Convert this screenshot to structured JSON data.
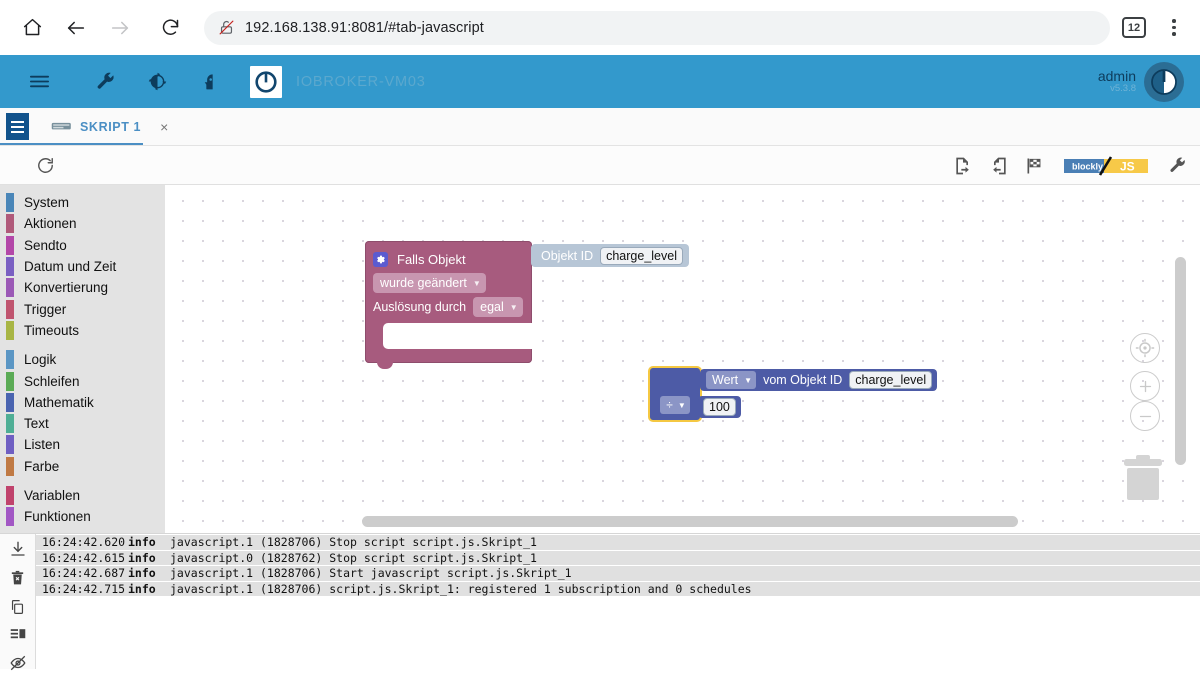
{
  "browser": {
    "url": "192.168.138.91:8081/#tab-javascript",
    "tab_count": "12",
    "icons": {
      "home": "home-icon",
      "back": "back-arrow-icon",
      "forward": "forward-arrow-icon",
      "reload": "reload-icon",
      "not_secure": "not-secure-icon",
      "menu": "kebab-menu-icon"
    }
  },
  "app_header": {
    "host": "IOBROKER-VM03",
    "user": "admin",
    "version": "v5.3.8",
    "accent": "#3399cc",
    "icons": [
      "hamburger-menu-icon",
      "wrench-icon",
      "contrast-icon",
      "user-head-icon",
      "iobroker-logo-icon"
    ]
  },
  "script_tab": {
    "label": "SKRIPT 1",
    "close": "×",
    "icon": "blockly-script-icon"
  },
  "blockly_toolbar": {
    "reload": "reload-icon",
    "export": "export-blocks-icon",
    "import": "import-blocks-icon",
    "flag": "checkered-flag-icon",
    "toggle_left": "blockly",
    "toggle_right": "JS",
    "settings": "wrench-icon"
  },
  "palette": {
    "groups": [
      {
        "items": [
          {
            "label": "System",
            "color": "#4a86b8"
          },
          {
            "label": "Aktionen",
            "color": "#b05a7a"
          },
          {
            "label": "Sendto",
            "color": "#b347a8"
          },
          {
            "label": "Datum und Zeit",
            "color": "#7a5fc2"
          },
          {
            "label": "Konvertierung",
            "color": "#9b59b6"
          },
          {
            "label": "Trigger",
            "color": "#c0556f"
          },
          {
            "label": "Timeouts",
            "color": "#a8b544"
          }
        ]
      },
      {
        "items": [
          {
            "label": "Logik",
            "color": "#5b96c4"
          },
          {
            "label": "Schleifen",
            "color": "#5bab56"
          },
          {
            "label": "Mathematik",
            "color": "#4a64b0"
          },
          {
            "label": "Text",
            "color": "#4fae95"
          },
          {
            "label": "Listen",
            "color": "#6f5fc2"
          },
          {
            "label": "Farbe",
            "color": "#c07a44"
          }
        ]
      },
      {
        "items": [
          {
            "label": "Variablen",
            "color": "#c0436c"
          },
          {
            "label": "Funktionen",
            "color": "#a257c4"
          }
        ]
      }
    ]
  },
  "workspace": {
    "if_block": {
      "title": "Falls Objekt",
      "condition": "wurde geändert",
      "trigger_label": "Auslösung durch",
      "trigger_value": "egal",
      "color": "#a75b7e",
      "mutator": "gear-icon"
    },
    "objid_block": {
      "label": "Objekt ID",
      "value": "charge_level",
      "color": "#b7c6d6"
    },
    "math_block": {
      "operator": "÷",
      "color": "#4d5ba6",
      "selected_outline": "#f5c842"
    },
    "getvalue_block": {
      "mode": "Wert",
      "label": "vom Objekt ID",
      "value": "charge_level"
    },
    "number_block": {
      "value": "100"
    },
    "controls": {
      "center": "center-target-icon",
      "zoom_in": "zoom-in-icon",
      "zoom_out": "zoom-out-icon",
      "trash": "trash-icon"
    }
  },
  "log": {
    "tools": [
      "scroll-to-bottom-icon",
      "clear-log-icon",
      "copy-log-icon",
      "layout-log-icon",
      "hide-log-icon"
    ],
    "columns": [
      "time",
      "severity",
      "message"
    ],
    "rows": [
      {
        "time": "16:24:42.620",
        "severity": "info",
        "message": "javascript.1 (1828706) Stop script script.js.Skript_1"
      },
      {
        "time": "16:24:42.615",
        "severity": "info",
        "message": "javascript.0 (1828762) Stop script script.js.Skript_1"
      },
      {
        "time": "16:24:42.687",
        "severity": "info",
        "message": "javascript.1 (1828706) Start javascript script.js.Skript_1"
      },
      {
        "time": "16:24:42.715",
        "severity": "info",
        "message": "javascript.1 (1828706) script.js.Skript_1: registered 1 subscription and 0 schedules"
      }
    ]
  }
}
